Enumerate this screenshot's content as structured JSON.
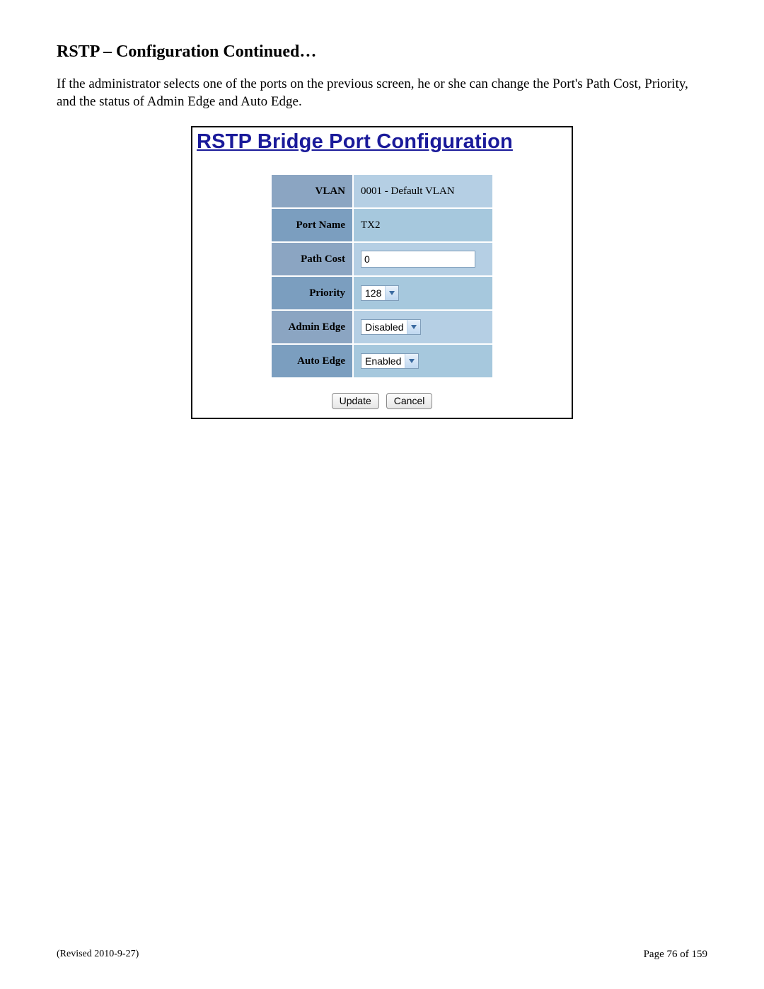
{
  "section_title": "RSTP – Configuration Continued…",
  "intro_text": "If the administrator selects one of the ports on the previous screen, he or she can change the Port's Path Cost, Priority, and the status of Admin Edge and Auto Edge.",
  "panel": {
    "title": "RSTP Bridge Port Configuration",
    "rows": {
      "vlan": {
        "label": "VLAN",
        "value": "0001 - Default VLAN"
      },
      "port_name": {
        "label": "Port Name",
        "value": "TX2"
      },
      "path_cost": {
        "label": "Path Cost",
        "value": "0"
      },
      "priority": {
        "label": "Priority",
        "value": "128"
      },
      "admin_edge": {
        "label": "Admin Edge",
        "value": "Disabled"
      },
      "auto_edge": {
        "label": "Auto Edge",
        "value": "Enabled"
      }
    },
    "buttons": {
      "update": "Update",
      "cancel": "Cancel"
    }
  },
  "footer": {
    "revised": "(Revised 2010-9-27)",
    "page": "Page 76 of 159"
  }
}
